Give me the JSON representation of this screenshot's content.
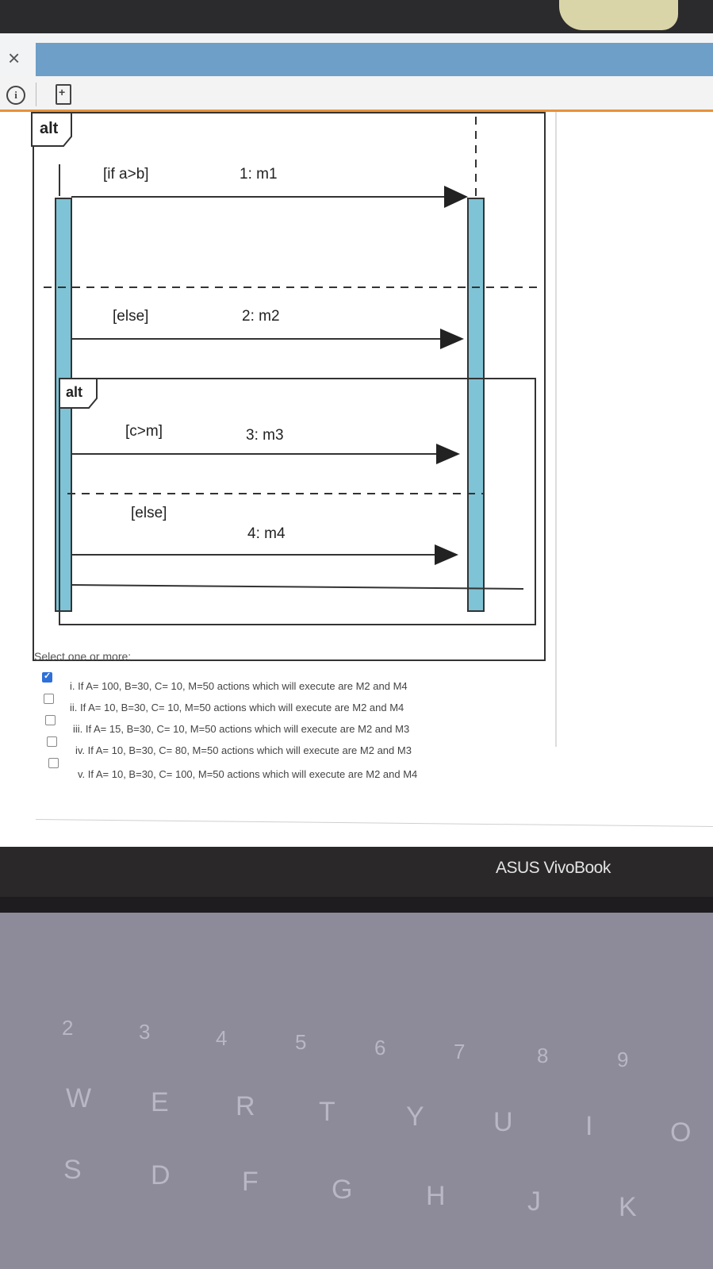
{
  "window": {
    "close_glyph": "×",
    "info_glyph": "i"
  },
  "diagram": {
    "outer_operator": "alt",
    "inner_operator": "alt",
    "guards": [
      "[if a>b]",
      "[else]",
      "[c>m]",
      "[else]"
    ],
    "messages": [
      "1: m1",
      "2: m2",
      "3: m3",
      "4: m4"
    ],
    "lifeline_color": "#7fc3d6"
  },
  "question": {
    "prompt": "Select one or more:",
    "options": [
      {
        "label": "i. If A= 100, B=30, C= 10, M=50 actions which will execute are M2 and M4",
        "checked": true
      },
      {
        "label": "ii. If A= 10, B=30, C= 10, M=50 actions which will execute are M2 and M4",
        "checked": false
      },
      {
        "label": "iii. If A= 15, B=30, C= 10, M=50 actions which will execute are M2 and M3",
        "checked": false
      },
      {
        "label": "iv. If A= 10, B=30, C= 80, M=50 actions which will execute are M2 and M3",
        "checked": false
      },
      {
        "label": "v. If A= 10, B=30, C= 100, M=50 actions which will execute are M2 and M4",
        "checked": false
      }
    ]
  },
  "laptop": {
    "brand": "ASUS VivoBook"
  },
  "keyboard": {
    "number_row": [
      "2",
      "3",
      "4",
      "5",
      "6",
      "7",
      "8",
      "9"
    ],
    "top_row": [
      "W",
      "E",
      "R",
      "T",
      "Y",
      "U",
      "I",
      "O"
    ],
    "home_row": [
      "S",
      "D",
      "F",
      "G",
      "H",
      "J",
      "K"
    ]
  }
}
